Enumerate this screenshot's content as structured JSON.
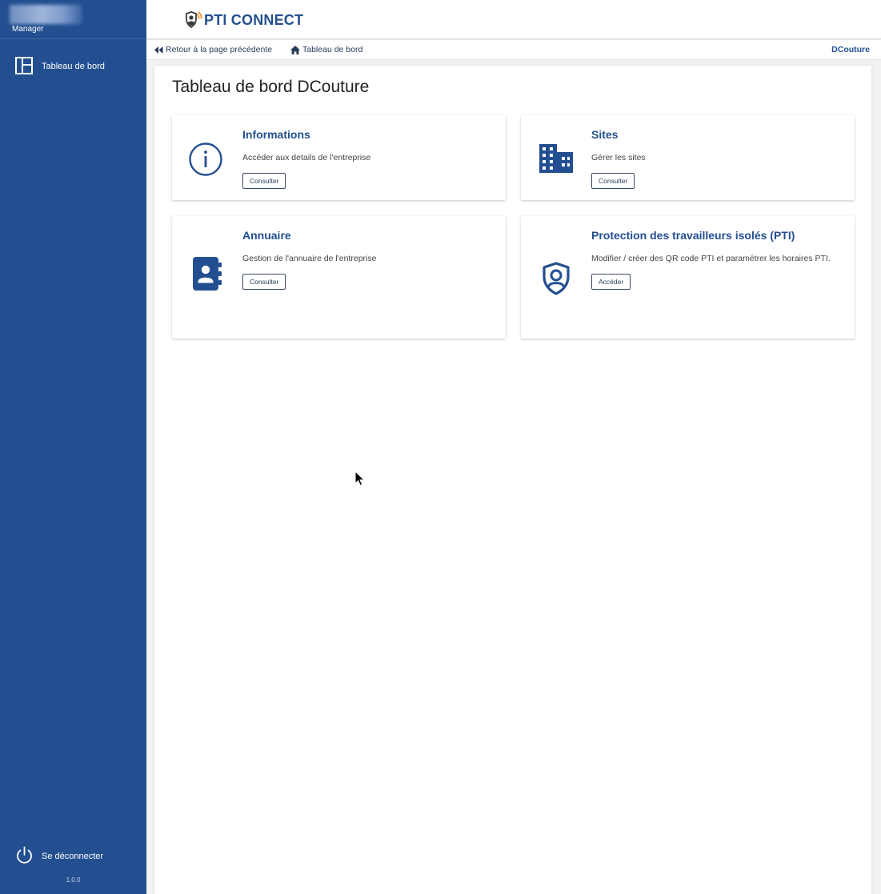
{
  "sidebar": {
    "role": "Manager",
    "nav": [
      {
        "label": "Tableau de bord",
        "icon": "dashboard-icon"
      }
    ],
    "logout_label": "Se déconnecter",
    "version": "1.0.0"
  },
  "header": {
    "app_name": "PTI CONNECT"
  },
  "breadcrumb": {
    "back_label": "Retour à la page précédente",
    "home_label": "Tableau de bord",
    "company": "DCouture"
  },
  "main": {
    "title": "Tableau de bord DCouture",
    "cards": [
      {
        "title": "Informations",
        "description": "Accéder aux details de l'entreprise",
        "button": "Consulter",
        "icon": "info-icon"
      },
      {
        "title": "Sites",
        "description": "Gérer les sites",
        "button": "Consulter",
        "icon": "building-icon"
      },
      {
        "title": "Annuaire",
        "description": "Gestion de l'annuaire de l'entreprise",
        "button": "Consulter",
        "icon": "contact-book-icon"
      },
      {
        "title": "Protection des travailleurs isolés (PTI)",
        "description": "Modifier / créer des QR code PTI et paramétrer les horaires PTI.",
        "button": "Accéder",
        "icon": "shield-user-icon"
      }
    ]
  },
  "colors": {
    "primary": "#234f91",
    "background": "#f2f2f2"
  }
}
